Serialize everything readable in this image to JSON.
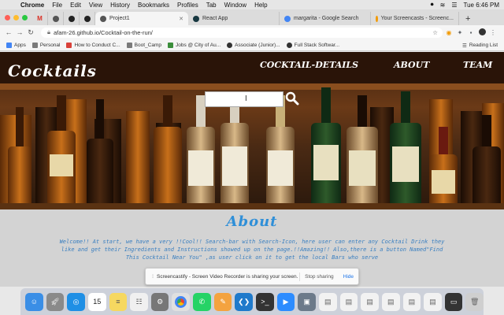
{
  "menubar": {
    "app": "Chrome",
    "items": [
      "File",
      "Edit",
      "View",
      "History",
      "Bookmarks",
      "Profiles",
      "Tab",
      "Window",
      "Help"
    ],
    "clock": "Tue 6:46 PM"
  },
  "tabs": [
    {
      "label": "M",
      "icon": "gmail-icon",
      "color": "#d93025",
      "small": true
    },
    {
      "label": "",
      "icon": "globe-icon",
      "color": "#555",
      "small": true
    },
    {
      "label": "",
      "icon": "github-icon",
      "color": "#222",
      "small": true
    },
    {
      "label": "",
      "icon": "github-icon",
      "color": "#222",
      "small": true
    },
    {
      "label": "Project1",
      "icon": "globe-icon",
      "color": "#555",
      "active": true
    },
    {
      "label": "React App",
      "icon": "react-icon",
      "color": "#173740"
    },
    {
      "label": "margarita - Google Search",
      "icon": "google-icon",
      "color": "#4285f4"
    },
    {
      "label": "Your Screencasts - Screenc...",
      "icon": "screencastify-icon",
      "color": "#f29900"
    }
  ],
  "address": {
    "url": "afam-26.github.io/Cocktail-on-the-run/"
  },
  "bookmarks": [
    {
      "label": "Apps",
      "color": "#4285f4"
    },
    {
      "label": "Personal",
      "color": "#7a7a7a"
    },
    {
      "label": "How to Conduct C...",
      "color": "#d9413a"
    },
    {
      "label": "Boot_Camp",
      "color": "#7a7a7a"
    },
    {
      "label": "Jobs @ City of Au...",
      "color": "#3b8e3b"
    },
    {
      "label": "Associate (Junior)...",
      "color": "#333"
    },
    {
      "label": "Full Stack Softwar...",
      "color": "#333"
    }
  ],
  "reading_list": "Reading List",
  "site": {
    "logo": "Cocktails",
    "nav": [
      "COCKTAIL-DETAILS",
      "ABOUT",
      "TEAM"
    ],
    "about_title": "About",
    "about_text": "Welcome!! At start, we have a very !!Cool!! Search-bar with Search-Icon, here user can enter any Cocktail Drink they like and get their Ingredients and Instructions showed up on the page.!!Amazing!! Also,there is a button Named\"Find This Cocktail Near You\" ,as user click on it to get the local Bars who serve"
  },
  "notification": {
    "message": "Screencastify - Screen Video Recorder is sharing your screen.",
    "stop": "Stop sharing",
    "hide": "Hide"
  },
  "dock_apps": [
    {
      "icon": "finder-icon",
      "color": "#3a8ee6"
    },
    {
      "icon": "launchpad-icon",
      "color": "#8a8a8a"
    },
    {
      "icon": "safari-icon",
      "color": "#1f8fe5"
    },
    {
      "icon": "calendar-icon",
      "color": "#ffffff",
      "label": "15"
    },
    {
      "icon": "notes-icon",
      "color": "#f6d860"
    },
    {
      "icon": "reminders-icon",
      "color": "#f0f0f0"
    },
    {
      "icon": "system-preferences-icon",
      "color": "#777"
    },
    {
      "icon": "chrome-icon",
      "color": "#e0e0e0"
    },
    {
      "icon": "whatsapp-icon",
      "color": "#25d366"
    },
    {
      "icon": "pen-icon",
      "color": "#f4a340"
    },
    {
      "icon": "vscode-icon",
      "color": "#1f7acb"
    },
    {
      "icon": "terminal-icon",
      "color": "#333"
    },
    {
      "icon": "zoom-icon",
      "color": "#2d8cff"
    },
    {
      "icon": "preview-icon",
      "color": "#6c7a8a"
    },
    {
      "icon": "document-icon",
      "color": "#f2f2f2"
    },
    {
      "icon": "document-icon",
      "color": "#f2f2f2"
    },
    {
      "icon": "document-icon",
      "color": "#f2f2f2"
    },
    {
      "icon": "document-icon",
      "color": "#f2f2f2"
    },
    {
      "icon": "document-icon",
      "color": "#f2f2f2"
    },
    {
      "icon": "document-icon",
      "color": "#f2f2f2"
    },
    {
      "icon": "screenshot-icon",
      "color": "#333"
    },
    {
      "icon": "trash-icon",
      "color": "#cfcfcf"
    }
  ]
}
